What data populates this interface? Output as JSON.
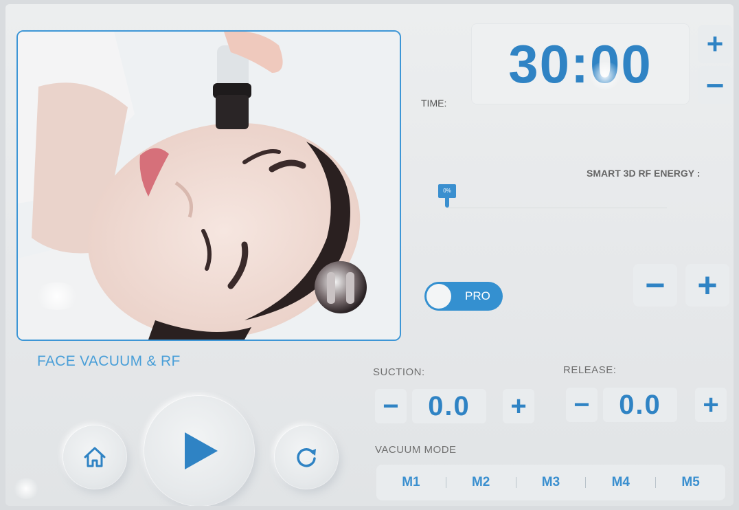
{
  "panel": {
    "mode_title": "FACE VACUUM & RF"
  },
  "controls": {
    "home_icon": "home-icon",
    "play_icon": "play-icon",
    "reset_icon": "refresh-icon"
  },
  "time": {
    "label": "TIME:",
    "value": "30:00",
    "plus": "+",
    "minus": "−"
  },
  "energy": {
    "label": "SMART 3D RF ENERGY :",
    "level_label": "0%",
    "level": 0,
    "pro_label": "PRO",
    "minus": "−",
    "plus": "+"
  },
  "suction": {
    "label": "SUCTION:",
    "value": "0.0",
    "minus": "−",
    "plus": "+"
  },
  "release": {
    "label": "RELEASE:",
    "value": "0.0",
    "minus": "−",
    "plus": "+"
  },
  "vacuum_mode": {
    "label": "VACUUM MODE",
    "modes": [
      "M1",
      "M2",
      "M3",
      "M4",
      "M5"
    ]
  },
  "colors": {
    "accent": "#2f83c4",
    "background": "#e6e8ea"
  }
}
